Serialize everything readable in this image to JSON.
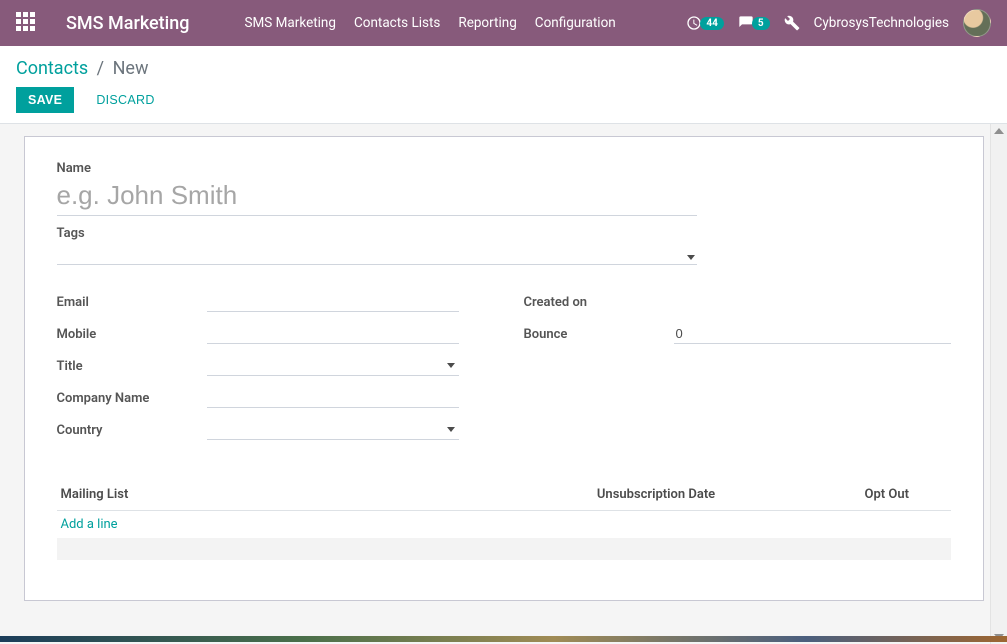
{
  "navbar": {
    "brand": "SMS Marketing",
    "menu": [
      "SMS Marketing",
      "Contacts Lists",
      "Reporting",
      "Configuration"
    ],
    "clock_badge": "44",
    "chat_badge": "5",
    "username": "CybrosysTechnologies"
  },
  "breadcrumb": {
    "parent": "Contacts",
    "current": "New"
  },
  "buttons": {
    "save": "SAVE",
    "discard": "DISCARD"
  },
  "form": {
    "labels": {
      "name": "Name",
      "tags": "Tags",
      "email": "Email",
      "mobile": "Mobile",
      "title": "Title",
      "company_name": "Company Name",
      "country": "Country",
      "created_on": "Created on",
      "bounce": "Bounce"
    },
    "name_placeholder": "e.g. John Smith",
    "values": {
      "name": "",
      "tags": "",
      "email": "",
      "mobile": "",
      "title": "",
      "company_name": "",
      "country": "",
      "created_on": "",
      "bounce": "0"
    }
  },
  "table": {
    "headers": {
      "mailing_list": "Mailing List",
      "unsub_date": "Unsubscription Date",
      "opt_out": "Opt Out"
    },
    "add_line": "Add a line"
  }
}
